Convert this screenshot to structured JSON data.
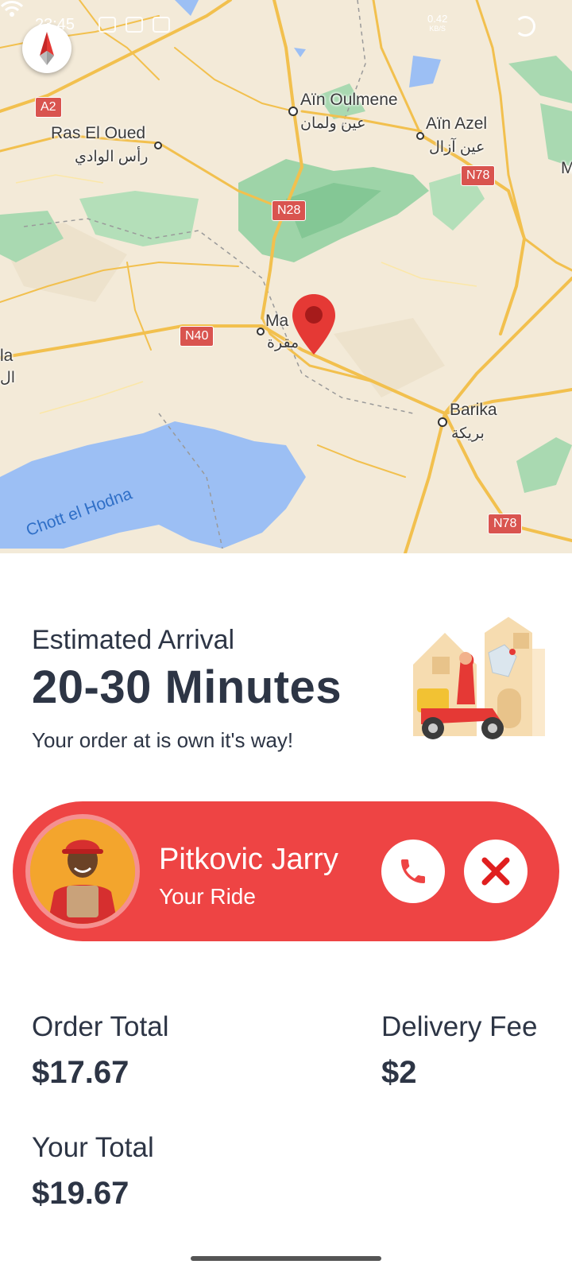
{
  "status_bar": {
    "time": "23:45",
    "speed_value": "0.42",
    "speed_unit": "KB/S"
  },
  "map": {
    "places": [
      {
        "name": "Aïn Oulmene",
        "name_ar": "عين ولمان"
      },
      {
        "name": "Ras El Oued",
        "name_ar": "رأس الوادي"
      },
      {
        "name": "Aïn Azel",
        "name_ar": "عين آزال"
      },
      {
        "name": "Ma",
        "name_ar": "مقرة"
      },
      {
        "name": "Barika",
        "name_ar": "بريكة"
      },
      {
        "name": "la",
        "name_ar": "ال"
      }
    ],
    "roads": [
      "A2",
      "N28",
      "N78",
      "N40",
      "N78"
    ],
    "lake": "Chott el Hodna",
    "edge_letter": "M"
  },
  "eta": {
    "label": "Estimated Arrival",
    "value": "20-30 Minutes",
    "message": "Your order at is own it's way!"
  },
  "driver": {
    "name": "Pitkovic Jarry",
    "role": "Your Ride"
  },
  "totals": {
    "order_total_label": "Order Total",
    "order_total_value": "$17.67",
    "delivery_fee_label": "Delivery Fee",
    "delivery_fee_value": "$2",
    "your_total_label": "Your Total",
    "your_total_value": "$19.67"
  },
  "colors": {
    "accent": "#ee4444",
    "text": "#2d3545",
    "map_land": "#f3ead8",
    "map_road": "#f2c04e",
    "map_water": "#9cbff4",
    "map_park": "#9ed4a8"
  },
  "icons": [
    "compass-icon",
    "map-pin-icon",
    "phone-icon",
    "close-icon",
    "wifi-icon",
    "battery-icon"
  ]
}
